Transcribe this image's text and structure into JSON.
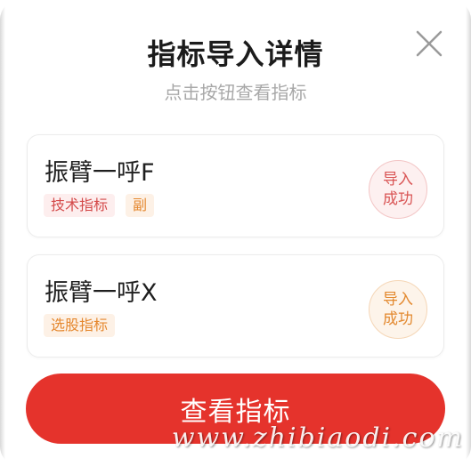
{
  "dialog": {
    "title": "指标导入详情",
    "subtitle": "点击按钮查看指标"
  },
  "items": [
    {
      "name": "振臂一呼F",
      "tags": [
        "技术指标",
        "副"
      ],
      "status_line1": "导入",
      "status_line2": "成功",
      "status_color": "#d95555"
    },
    {
      "name": "振臂一呼X",
      "tags": [
        "选股指标"
      ],
      "status_line1": "导入",
      "status_line2": "成功",
      "status_color": "#e3892f"
    }
  ],
  "actions": {
    "view_label": "查看指标"
  },
  "watermark": "www.zhibiaodi.com",
  "colors": {
    "primary": "#e5332c",
    "tag_red": "#d44a4a",
    "tag_orange": "#e5882f"
  }
}
